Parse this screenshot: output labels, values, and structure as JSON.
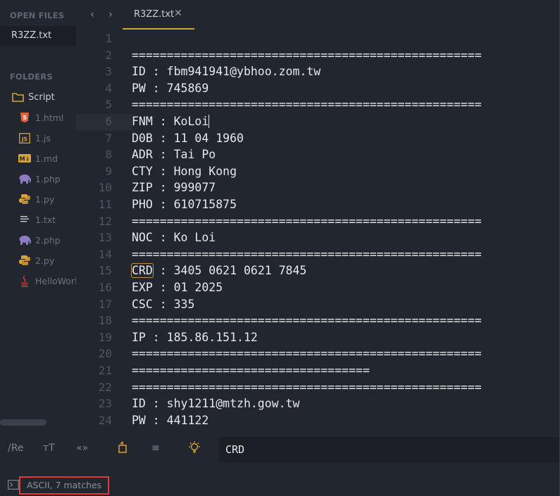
{
  "sidebar": {
    "open_files_title": "OPEN FILES",
    "open_file": "R3ZZ.txt",
    "folders_title": "FOLDERS",
    "folder": {
      "label": "Script",
      "icon": "folder-icon"
    },
    "files": [
      {
        "label": "1.html",
        "icon": "html5-icon",
        "color": "#e4633a"
      },
      {
        "label": "1.js",
        "icon": "js-icon",
        "color": "#d7a23c"
      },
      {
        "label": "1.md",
        "icon": "markdown-icon",
        "color": "#d7a23c"
      },
      {
        "label": "1.php",
        "icon": "php-elephant-icon",
        "color": "#8e7cc3"
      },
      {
        "label": "1.py",
        "icon": "python-icon",
        "color": "#d7a23c"
      },
      {
        "label": "1.txt",
        "icon": "text-file-icon",
        "color": "#c8ccd4"
      },
      {
        "label": "2.php",
        "icon": "php-elephant-icon",
        "color": "#8e7cc3"
      },
      {
        "label": "2.py",
        "icon": "python-icon",
        "color": "#d7a23c"
      },
      {
        "label": "HelloWorl",
        "icon": "java-icon",
        "color": "#e03a3a"
      }
    ]
  },
  "tabs": {
    "back": "‹",
    "forward": "›",
    "active_tab": "R3ZZ.txt",
    "close": "✕"
  },
  "editor": {
    "lines": [
      {
        "n": "1",
        "text": ""
      },
      {
        "n": "2",
        "text": "=================================================="
      },
      {
        "n": "3",
        "text": "ID : fbm941941@ybhoo.zom.tw"
      },
      {
        "n": "4",
        "text": "PW : 745869"
      },
      {
        "n": "5",
        "text": "=================================================="
      },
      {
        "n": "6",
        "text": "FNM : KoLoi"
      },
      {
        "n": "7",
        "text": "D0B : 11 04 1960"
      },
      {
        "n": "8",
        "text": "ADR : Tai Po"
      },
      {
        "n": "9",
        "text": "CTY : Hong Kong"
      },
      {
        "n": "10",
        "text": "ZIP : 999077"
      },
      {
        "n": "11",
        "text": "PHO : 610715875"
      },
      {
        "n": "12",
        "text": "=================================================="
      },
      {
        "n": "13",
        "text": "NOC : Ko Loi"
      },
      {
        "n": "14",
        "text": "=================================================="
      },
      {
        "n": "15",
        "pre": "",
        "match": "CRD",
        "post": " : 3405 0621 0621 7845"
      },
      {
        "n": "16",
        "text": "EXP : 01 2025"
      },
      {
        "n": "17",
        "text": "CSC : 335"
      },
      {
        "n": "18",
        "text": "=================================================="
      },
      {
        "n": "19",
        "text": "IP : 185.86.151.12"
      },
      {
        "n": "20",
        "text": "=================================================="
      },
      {
        "n": "21",
        "text": "=================================="
      },
      {
        "n": "22",
        "text": "=================================================="
      },
      {
        "n": "23",
        "text": "ID : shy1211@mtzh.gow.tw"
      },
      {
        "n": "24",
        "text": "PW : 441122"
      }
    ],
    "active_line": "6"
  },
  "findbar": {
    "regex": "/Re",
    "case": "тT",
    "whole_word": "«»",
    "wrap": "wrap-icon",
    "in_selection": "≡",
    "highlight": "bulb-icon",
    "query": "CRD"
  },
  "status": {
    "text": "ASCII, 7 matches",
    "highlight_color": "#e03a3a"
  }
}
